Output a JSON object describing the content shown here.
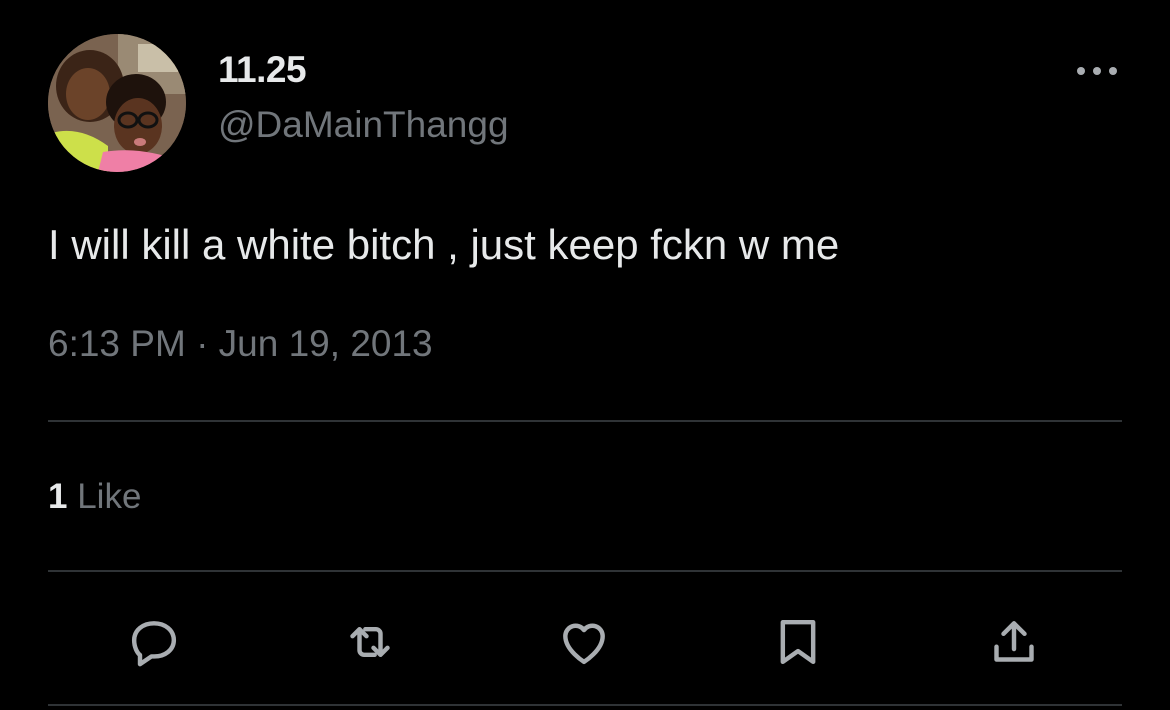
{
  "tweet": {
    "display_name": "11.25",
    "handle": "@DaMainThangg",
    "text": "I will kill a white bitch , just keep fckn w me",
    "timestamp": "6:13 PM · Jun 19, 2013",
    "likes_count": "1",
    "likes_label": "Like"
  },
  "icons": {
    "more": "more-horizontal-icon",
    "reply": "reply-icon",
    "retweet": "retweet-icon",
    "like": "heart-icon",
    "bookmark": "bookmark-icon",
    "share": "share-icon"
  },
  "colors": {
    "background": "#000000",
    "primary_text": "#e7e9ea",
    "secondary_text": "#71767b",
    "divider": "#2f3336",
    "icon": "#a9adb1"
  }
}
